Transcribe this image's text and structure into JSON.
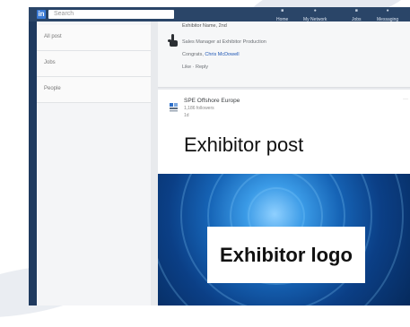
{
  "search": {
    "placeholder": "Search"
  },
  "logo": {
    "glyph": "in"
  },
  "nav": [
    {
      "label": "Home"
    },
    {
      "label": "My Network"
    },
    {
      "label": "Jobs"
    },
    {
      "label": "Messaging"
    }
  ],
  "left_panel": {
    "items": [
      {
        "label": "All post"
      },
      {
        "label": "Jobs"
      },
      {
        "label": "People"
      }
    ]
  },
  "comment": {
    "line1": "Exhibitor Name, 2nd",
    "line2": "Sales Manager at Exhibitor Production",
    "line3_prefix": "Congrats,",
    "line3_link": "Chris McDowell",
    "line4": "Like · Reply"
  },
  "post": {
    "author": "SPE Offshore Europe",
    "followers": "1,186 followers",
    "time": "1d",
    "menu": "···",
    "title": "Exhibitor post",
    "logo_text": "Exhibitor logo"
  }
}
